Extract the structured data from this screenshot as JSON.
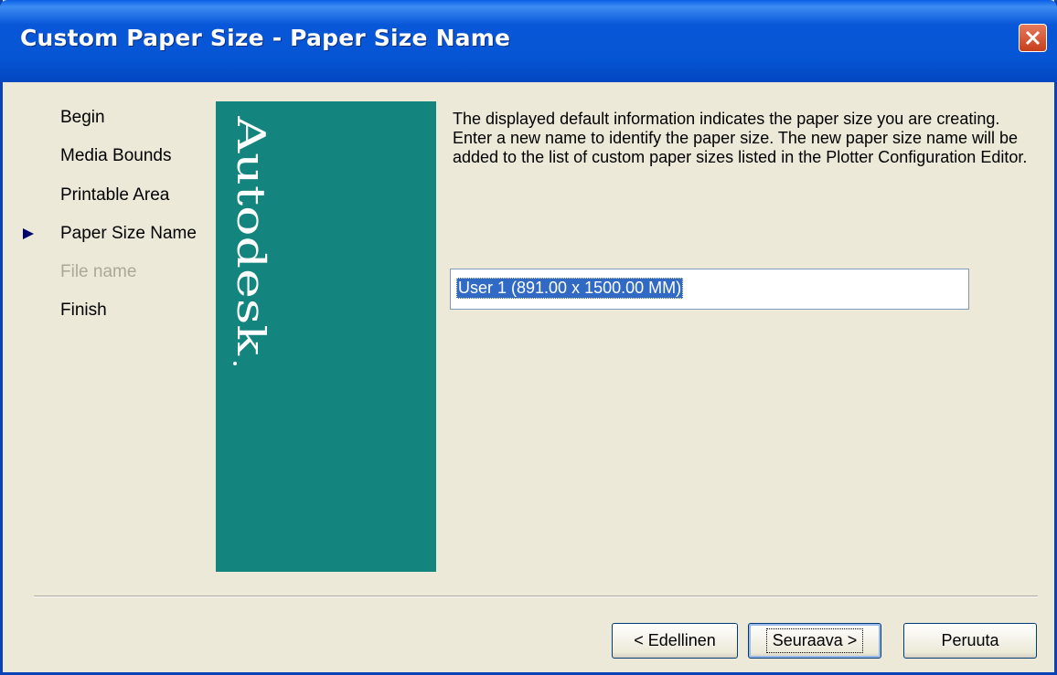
{
  "window": {
    "title": "Custom Paper Size - Paper Size Name"
  },
  "steps": [
    {
      "label": "Begin",
      "state": "normal"
    },
    {
      "label": "Media Bounds",
      "state": "normal"
    },
    {
      "label": "Printable Area",
      "state": "normal"
    },
    {
      "label": "Paper Size Name",
      "state": "current"
    },
    {
      "label": "File name",
      "state": "disabled"
    },
    {
      "label": "Finish",
      "state": "normal"
    }
  ],
  "banner": {
    "logo_text": "Autodesk",
    "color": "#13847e"
  },
  "content": {
    "description": "The displayed default information indicates the paper size you are creating. Enter a new name to identify the paper size. The new paper size name will be added to the list of custom paper sizes listed in the Plotter Configuration Editor.",
    "paper_size_name": "User 1 (891.00 x 1500.00 MM)"
  },
  "buttons": {
    "back": "< Edellinen",
    "next": "Seuraava >",
    "cancel": "Peruuta"
  },
  "colors": {
    "titlebar": "#0555d4",
    "selection": "#316ac5",
    "dialog_bg": "#ece9d8"
  }
}
